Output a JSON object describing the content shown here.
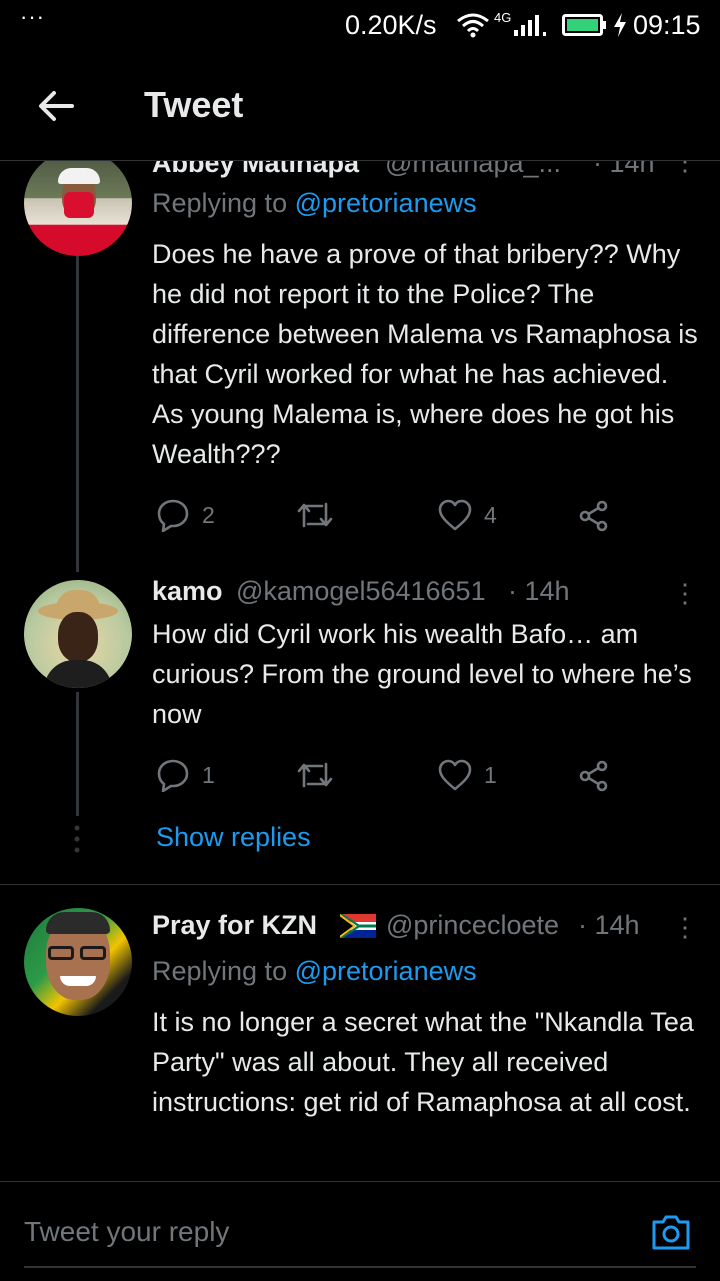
{
  "status_bar": {
    "dots": "···",
    "speed": "0.20K/s",
    "network": "4G",
    "time": "09:15"
  },
  "header": {
    "title": "Tweet"
  },
  "tweets": [
    {
      "name": "Abbey Matlhapa",
      "handle": "@matlhapa_...",
      "time": "· 14h",
      "replying_label": "Replying to",
      "replying_handle": "@pretorianews",
      "text": "Does he have a prove of that bribery?? Why he did not report it to the Police? The difference between Malema vs Ramaphosa is that Cyril worked for what he has achieved. As young Malema is, where does he got his Wealth???",
      "replies": "2",
      "retweets": "",
      "likes": "4"
    },
    {
      "name": "kamo",
      "handle": "@kamogel56416651",
      "time": "· 14h",
      "text": "How did Cyril work his wealth Bafo… am curious? From the ground level to where he’s now",
      "replies": "1",
      "retweets": "",
      "likes": "1",
      "show_replies": "Show replies"
    },
    {
      "name": "Pray for KZN",
      "handle": "@princecloete",
      "time": "· 14h",
      "replying_label": "Replying to",
      "replying_handle": "@pretorianews",
      "text": "It is no longer a secret what the \"Nkandla Tea Party\" was all about. They all received instructions: get rid of Ramaphosa at all cost."
    }
  ],
  "composer": {
    "placeholder": "Tweet your reply"
  },
  "colors": {
    "accent": "#1d9bf0",
    "muted": "#71767b",
    "text": "#e7e9ea",
    "background": "#000000"
  }
}
